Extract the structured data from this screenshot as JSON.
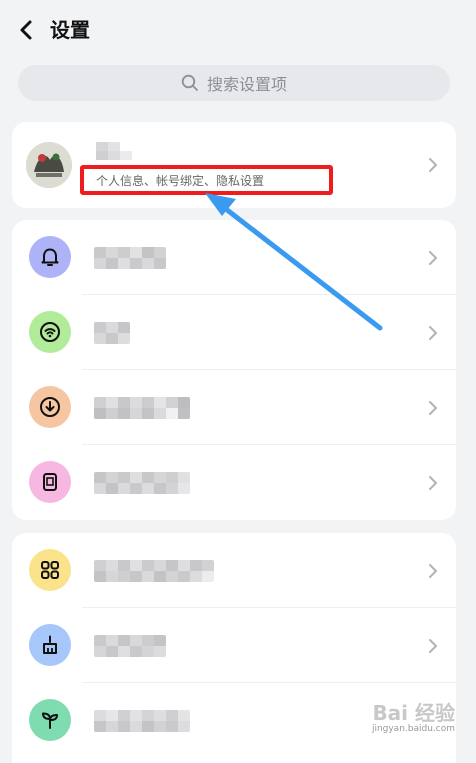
{
  "header": {
    "title": "设置"
  },
  "search": {
    "placeholder": "搜索设置项"
  },
  "profile": {
    "subtitle": "个人信息、帐号绑定、隐私设置"
  },
  "colors": {
    "accent_annotation": "#ee1c1c",
    "arrow": "#3a9af0",
    "notification_icon_bg": "#aeb2f7",
    "wifi_icon_bg": "#b0ec9a",
    "download_icon_bg": "#f6c6a3",
    "contact_icon_bg": "#f6b8e0",
    "apps_icon_bg": "#fae38a",
    "clean_icon_bg": "#a7c7fb",
    "plant_icon_bg": "#7edcb0"
  },
  "list1": {
    "items": [
      {
        "icon": "bell-icon"
      },
      {
        "icon": "wifi-icon"
      },
      {
        "icon": "download-icon"
      },
      {
        "icon": "contact-card-icon"
      }
    ]
  },
  "list2": {
    "items": [
      {
        "icon": "apps-grid-icon"
      },
      {
        "icon": "broom-icon"
      },
      {
        "icon": "sprout-icon"
      }
    ]
  },
  "watermark": {
    "text": "Bai 经验",
    "url_text": "jingyan.baidu.com"
  }
}
